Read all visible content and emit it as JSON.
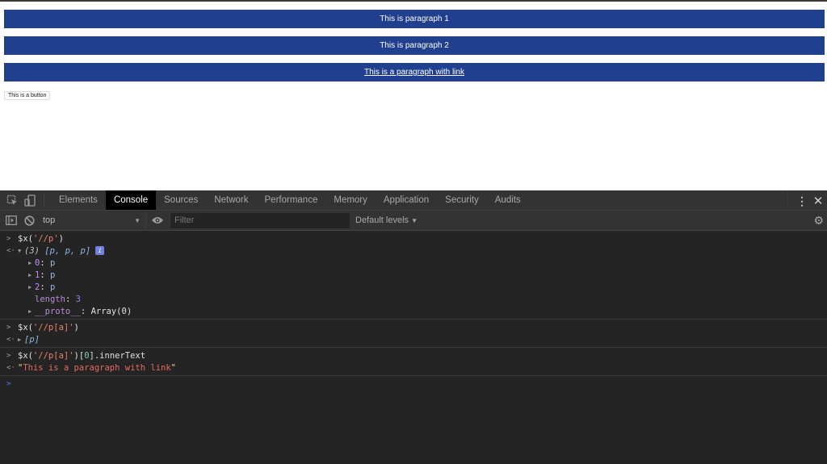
{
  "page": {
    "paragraphs": [
      "This is paragraph 1",
      "This is paragraph 2"
    ],
    "link_paragraph": "This is a paragraph with link",
    "button_label": "This is a button",
    "colors": {
      "paragraph_bg": "#213f8f",
      "paragraph_text": "#ffffff"
    }
  },
  "devtools": {
    "tabs": [
      {
        "label": "Elements",
        "active": false
      },
      {
        "label": "Console",
        "active": true
      },
      {
        "label": "Sources",
        "active": false
      },
      {
        "label": "Network",
        "active": false
      },
      {
        "label": "Performance",
        "active": false
      },
      {
        "label": "Memory",
        "active": false
      },
      {
        "label": "Application",
        "active": false
      },
      {
        "label": "Security",
        "active": false
      },
      {
        "label": "Audits",
        "active": false
      }
    ],
    "toolbar": {
      "context": "top",
      "filter_placeholder": "Filter",
      "filter_value": "",
      "levels": "Default levels"
    },
    "console": {
      "cmd1": {
        "fn": "$x(",
        "arg": "'//p'",
        "close": ")"
      },
      "res1": {
        "count": "(3)",
        "preview": "[p, p, p]",
        "info": "i",
        "items": [
          {
            "key": "0",
            "value": "p"
          },
          {
            "key": "1",
            "value": "p"
          },
          {
            "key": "2",
            "value": "p"
          }
        ],
        "length_key": "length",
        "length_value": "3",
        "proto_key": "__proto__",
        "proto_value": "Array(0)"
      },
      "cmd2": {
        "fn": "$x(",
        "arg": "'//p[a]'",
        "close": ")"
      },
      "res2": {
        "preview": "[p]"
      },
      "cmd3": {
        "fn": "$x(",
        "arg": "'//p[a]'",
        "mid": ")[",
        "idx": "0",
        "tail": "].innerText"
      },
      "res3": {
        "value": "This is a paragraph with link"
      }
    }
  }
}
